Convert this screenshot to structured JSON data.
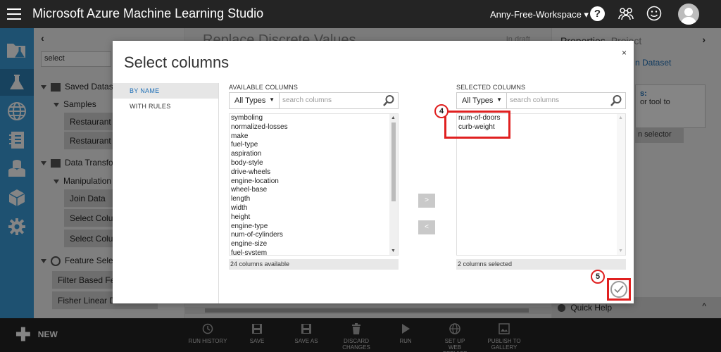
{
  "topbar": {
    "app_title": "Microsoft Azure Machine Learning Studio",
    "workspace": "Anny-Free-Workspace ▾",
    "help_label": "?"
  },
  "palette": {
    "collapse_label": "‹",
    "search_value": "select",
    "groups": {
      "saved": "Saved Datas",
      "samples": "Samples",
      "restaurant1": "Restaurant c",
      "restaurant2": "Restaurant f",
      "transform": "Data Transfo",
      "manipulation": "Manipulation",
      "join": "Join Data",
      "select1": "Select Colun",
      "select2": "Select Colun",
      "feature": "Feature Sele",
      "filter": "Filter Based Fea",
      "fisher": "Fisher Linear Di..."
    }
  },
  "canvas": {
    "title": "Replace Discrete Values",
    "status": "In draft"
  },
  "props": {
    "tab1": "Properties",
    "tab2": "Project",
    "chevron": "›",
    "dataset": "n Dataset",
    "info_title": "s:",
    "info_body": "or tool to",
    "launch_label": "n selector",
    "quick_help": "Quick Help",
    "quick_help_toggle": "^"
  },
  "bottombar": {
    "new_label": "NEW",
    "commands": [
      {
        "label": "RUN HISTORY"
      },
      {
        "label": "SAVE"
      },
      {
        "label": "SAVE AS"
      },
      {
        "label": "DISCARD CHANGES"
      },
      {
        "label": "RUN"
      },
      {
        "label": "SET UP WEB SERVICE"
      },
      {
        "label": "PUBLISH TO GALLERY"
      }
    ]
  },
  "dialog": {
    "title": "Select columns",
    "close_label": "×",
    "tabs": [
      "BY NAME",
      "WITH RULES"
    ],
    "available": {
      "heading": "AVAILABLE COLUMNS",
      "type_filter": "All Types",
      "search_placeholder": "search columns",
      "columns": [
        "symboling",
        "normalized-losses",
        "make",
        "fuel-type",
        "aspiration",
        "body-style",
        "drive-wheels",
        "engine-location",
        "wheel-base",
        "length",
        "width",
        "height",
        "engine-type",
        "num-of-cylinders",
        "engine-size",
        "fuel-system"
      ],
      "footer": "24 columns available"
    },
    "selected": {
      "heading": "SELECTED COLUMNS",
      "type_filter": "All Types",
      "search_placeholder": "search columns",
      "columns": [
        "num-of-doors",
        "curb-weight"
      ],
      "footer": "2 columns selected"
    },
    "move_right": ">",
    "move_left": "<",
    "callout_4": "4",
    "callout_5": "5"
  },
  "colors": {
    "topbar_bg": "#242424",
    "rail_bg": "#3a9bd8",
    "accent_blue": "#1e6fb7",
    "callout_red": "#e02020"
  }
}
